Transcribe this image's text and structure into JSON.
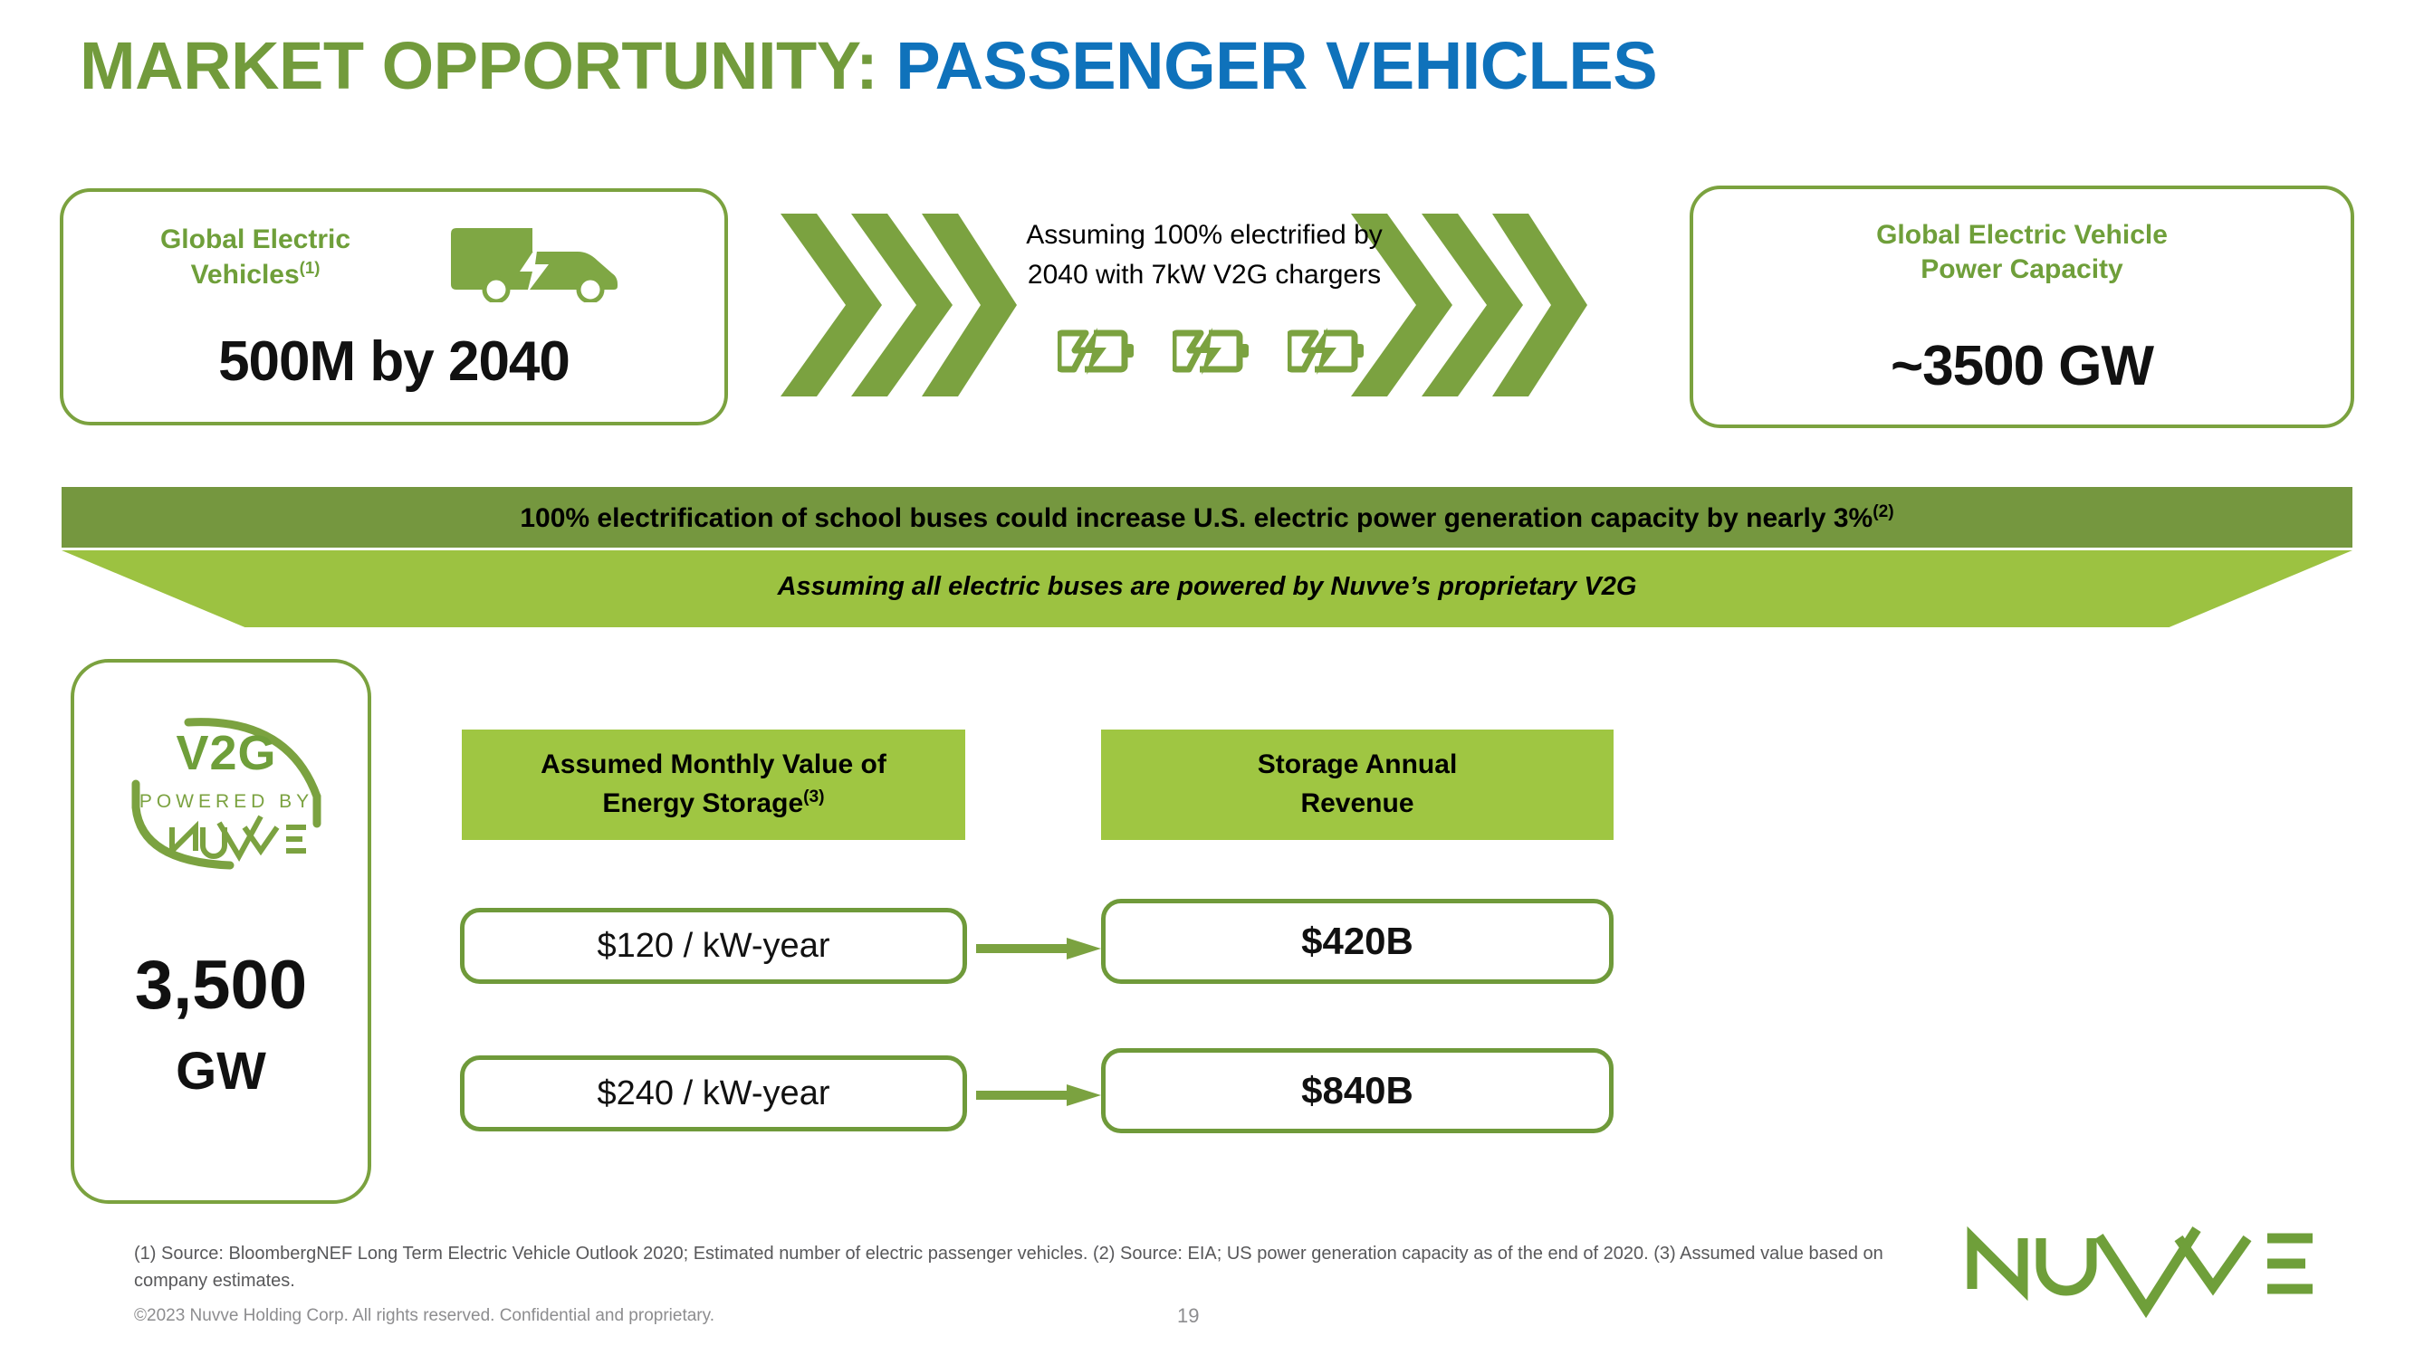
{
  "title": {
    "part_green": "MARKET OPPORTUNITY:",
    "part_blue": "PASSENGER VEHICLES"
  },
  "cards": {
    "left": {
      "label_line1": "Global Electric",
      "label_line2": "Vehicles",
      "label_footnote": "(1)",
      "value": "500M by 2040",
      "icon": "electric-van-icon"
    },
    "right": {
      "label_line1": "Global Electric Vehicle",
      "label_line2": "Power Capacity",
      "value": "~3500 GW"
    }
  },
  "center": {
    "assumption_line1": "Assuming 100% electrified by",
    "assumption_line2": "2040 with 7kW V2G chargers",
    "battery_icons": [
      "battery-charging-icon",
      "battery-charging-icon",
      "battery-charging-icon"
    ],
    "chevron_icon": "chevron-right-icon"
  },
  "banner": {
    "top_text": "100% electrification of school buses could increase U.S. electric power generation capacity by nearly 3%",
    "top_footnote": "(2)",
    "bottom_text": "Assuming all electric buses are powered by Nuvve’s proprietary V2G"
  },
  "v2g_card": {
    "logo_title": "V2G",
    "logo_tagline": "POWERED BY",
    "logo_brand": "NUVVE",
    "value": "3,500",
    "unit": "GW"
  },
  "table": {
    "headers": [
      {
        "line1": "Assumed Monthly Value of",
        "line2": "Energy Storage",
        "footnote": "(3)"
      },
      {
        "line1": "Storage Annual",
        "line2": "Revenue",
        "footnote": ""
      }
    ],
    "rows": [
      {
        "input": "$120 / kW-year",
        "output": "$420B",
        "arrow_icon": "arrow-right-icon"
      },
      {
        "input": "$240 / kW-year",
        "output": "$840B",
        "arrow_icon": "arrow-right-icon"
      }
    ]
  },
  "footer": {
    "footnotes": "(1) Source: BloombergNEF Long Term Electric Vehicle Outlook 2020; Estimated number of electric passenger vehicles. (2) Source: EIA; US power generation capacity as of the end of 2020. (3) Assumed value based on company estimates.",
    "copyright": "©2023 Nuvve Holding Corp. All rights reserved. Confidential and proprietary.",
    "page_number": "19",
    "logo": "nuvve-logo"
  },
  "colors": {
    "green_title": "#729b3c",
    "blue_title": "#0f72bb",
    "green_accent": "#7ba23f",
    "green_banner_dark": "#75973f",
    "green_banner_light": "#9cc241",
    "green_header": "#9fc642"
  }
}
